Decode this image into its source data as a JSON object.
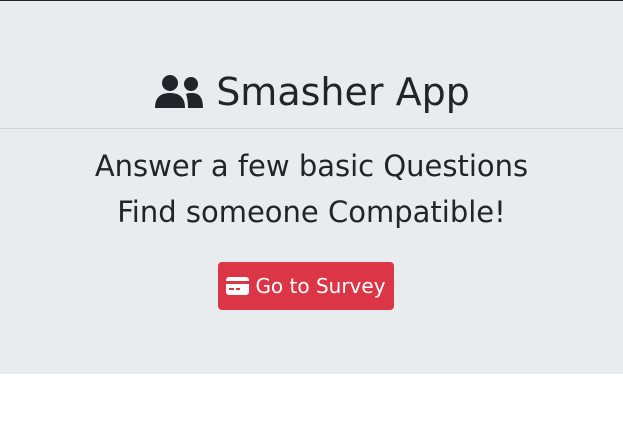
{
  "app": {
    "title": "Smasher App",
    "title_icon": "users-icon"
  },
  "hero": {
    "line1": "Answer a few basic Questions",
    "line2": "Find someone Compatible!"
  },
  "survey_button": {
    "label": "Go to Survey",
    "icon": "credit-card-icon",
    "color": "#dc3545"
  },
  "theme": {
    "jumbotron_bg": "#e9ecef",
    "text_color": "#212529"
  }
}
